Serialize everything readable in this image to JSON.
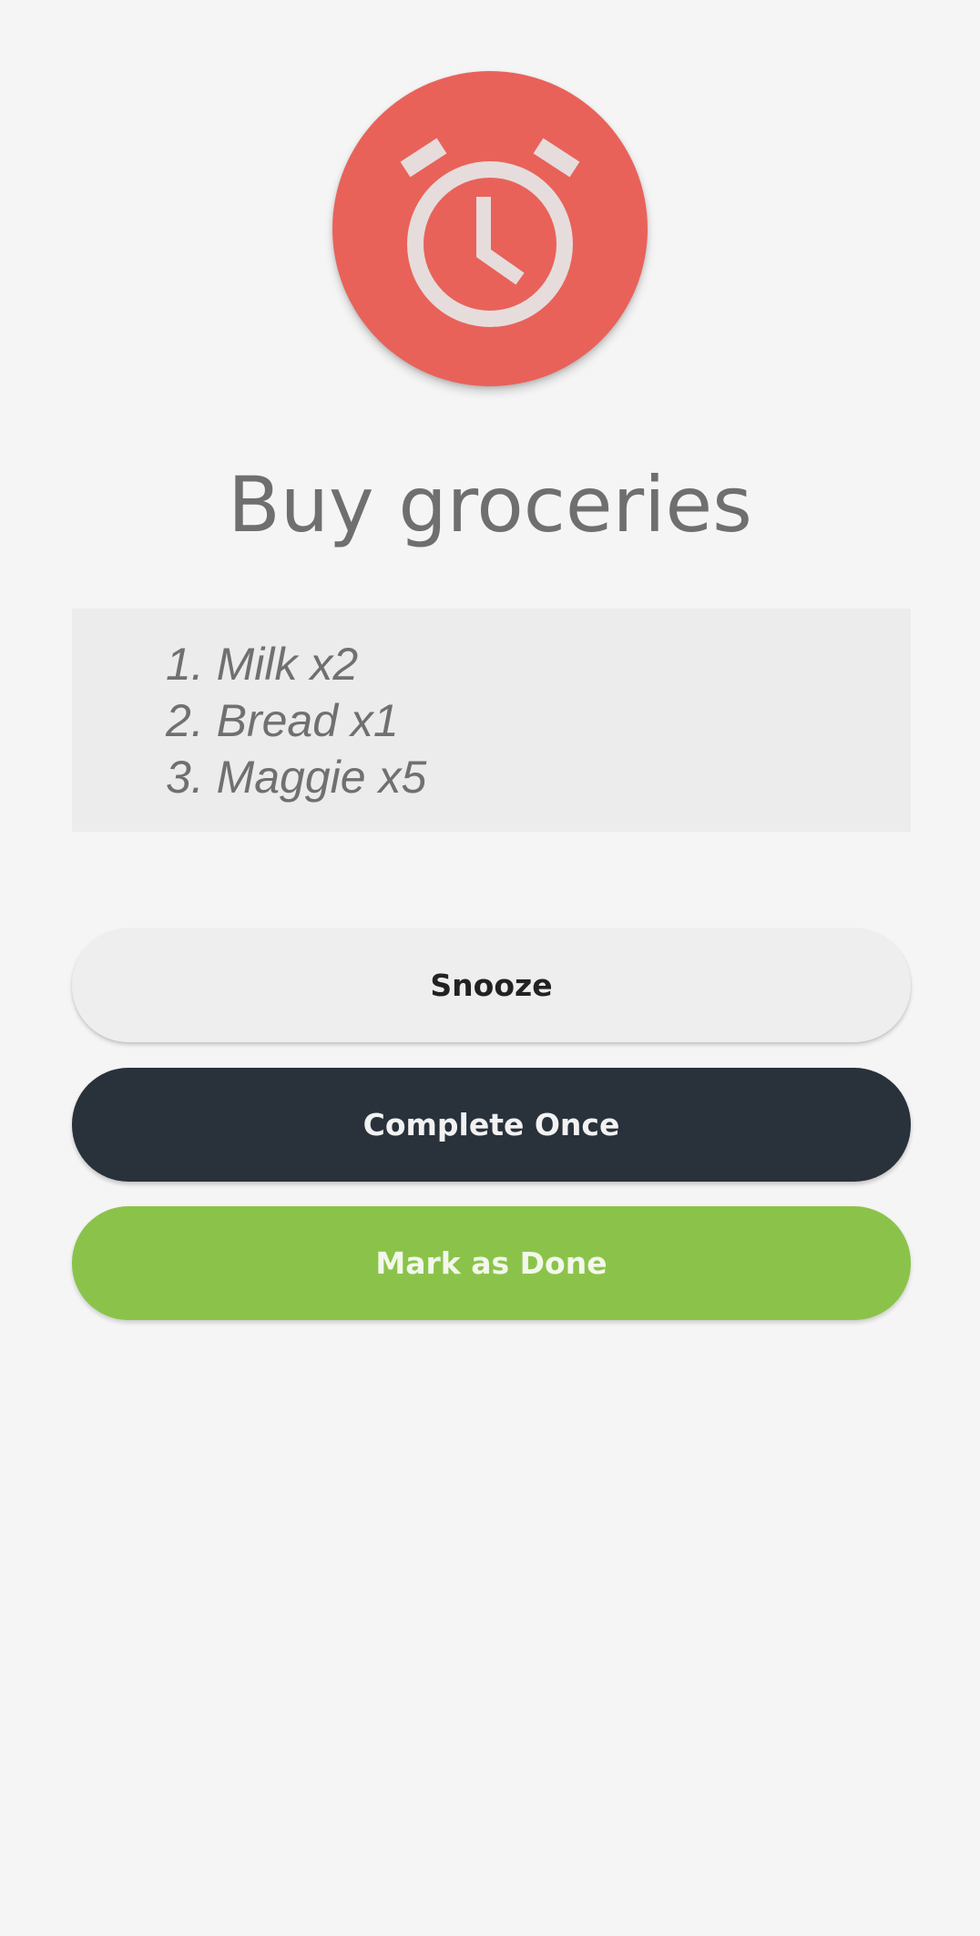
{
  "reminder": {
    "icon": "alarm-clock-icon",
    "title": "Buy groceries",
    "notes": [
      "1. Milk x2",
      "2. Bread x1",
      "3. Maggie x5"
    ]
  },
  "actions": {
    "snooze_label": "Snooze",
    "complete_once_label": "Complete Once",
    "mark_done_label": "Mark as Done"
  },
  "colors": {
    "background": "#f5f5f5",
    "alarm_circle": "#e8625a",
    "alarm_icon": "#e6dcdc",
    "title_text": "#6f6f6f",
    "notes_background": "#ececec",
    "snooze_button": "#eeeeee",
    "complete_once_button": "#29313b",
    "mark_done_button": "#8bc34a"
  }
}
